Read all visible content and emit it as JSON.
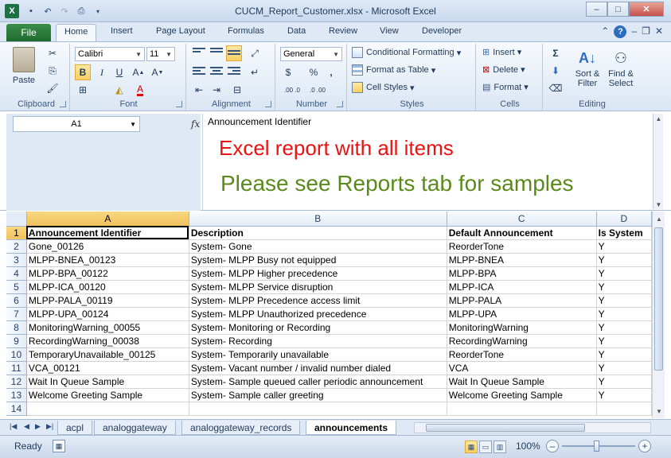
{
  "window": {
    "title": "CUCM_Report_Customer.xlsx - Microsoft Excel",
    "qat_icons": [
      "excel-logo-icon",
      "save-icon",
      "undo-icon",
      "redo-icon",
      "print-preview-icon"
    ]
  },
  "tabs": {
    "file": "File",
    "items": [
      "Home",
      "Insert",
      "Page Layout",
      "Formulas",
      "Data",
      "Review",
      "View",
      "Developer"
    ],
    "active": "Home"
  },
  "ribbon": {
    "clipboard": {
      "label": "Clipboard",
      "paste": "Paste"
    },
    "font": {
      "label": "Font",
      "name": "Calibri",
      "size": "11",
      "bold": "B",
      "italic": "I",
      "underline": "U"
    },
    "alignment": {
      "label": "Alignment"
    },
    "number": {
      "label": "Number",
      "format": "General",
      "currency": "$",
      "percent": "%",
      "comma": ",",
      "inc_decimal": ".00 .0",
      "dec_decimal": ".0 .00"
    },
    "styles": {
      "label": "Styles",
      "conditional": "Conditional Formatting",
      "format_table": "Format as Table",
      "cell_styles": "Cell Styles"
    },
    "cells": {
      "label": "Cells",
      "insert": "Insert",
      "delete": "Delete",
      "format": "Format"
    },
    "editing": {
      "label": "Editing",
      "sort_l1": "Sort &",
      "sort_l2": "Filter",
      "find_l1": "Find &",
      "find_l2": "Select",
      "autosum": "Σ"
    }
  },
  "formula_bar": {
    "name_box": "A1",
    "fx": "fx",
    "content": "Announcement Identifier",
    "overlay_red": "Excel report with all items",
    "overlay_green": "Please see Reports tab for samples"
  },
  "grid": {
    "columns": [
      "A",
      "B",
      "C",
      "D"
    ],
    "rows": [
      [
        "1",
        "Announcement Identifier",
        "Description",
        "Default Announcement",
        "Is System"
      ],
      [
        "2",
        "Gone_00126",
        "System- Gone",
        "ReorderTone",
        "Y"
      ],
      [
        "3",
        "MLPP-BNEA_00123",
        "System- MLPP Busy not equipped",
        "MLPP-BNEA",
        "Y"
      ],
      [
        "4",
        "MLPP-BPA_00122",
        "System- MLPP Higher precedence",
        "MLPP-BPA",
        "Y"
      ],
      [
        "5",
        "MLPP-ICA_00120",
        "System- MLPP Service disruption",
        "MLPP-ICA",
        "Y"
      ],
      [
        "6",
        "MLPP-PALA_00119",
        "System- MLPP Precedence access limit",
        "MLPP-PALA",
        "Y"
      ],
      [
        "7",
        "MLPP-UPA_00124",
        "System- MLPP Unauthorized precedence",
        "MLPP-UPA",
        "Y"
      ],
      [
        "8",
        "MonitoringWarning_00055",
        "System- Monitoring or Recording",
        "MonitoringWarning",
        "Y"
      ],
      [
        "9",
        "RecordingWarning_00038",
        "System- Recording",
        "RecordingWarning",
        "Y"
      ],
      [
        "10",
        "TemporaryUnavailable_00125",
        "System- Temporarily unavailable",
        "ReorderTone",
        "Y"
      ],
      [
        "11",
        "VCA_00121",
        "System- Vacant number / invalid number dialed",
        "VCA",
        "Y"
      ],
      [
        "12",
        "Wait In Queue Sample",
        "System- Sample queued caller periodic announcement",
        "Wait In Queue Sample",
        "Y"
      ],
      [
        "13",
        "Welcome Greeting Sample",
        "System- Sample caller greeting",
        "Welcome Greeting Sample",
        "Y"
      ],
      [
        "14",
        "",
        "",
        "",
        ""
      ]
    ]
  },
  "sheets": {
    "items": [
      "acpl",
      "analoggateway",
      "analoggateway_records",
      "announcements"
    ],
    "active": "announcements"
  },
  "status": {
    "ready": "Ready",
    "zoom": "100%",
    "zoom_level_percent": 100
  },
  "colors": {
    "accent": "#1e395b",
    "file_tab": "#1f6b2f",
    "selection": "#f1c15f",
    "red_text": "#ee1111",
    "green_text": "#5a8a1c"
  }
}
